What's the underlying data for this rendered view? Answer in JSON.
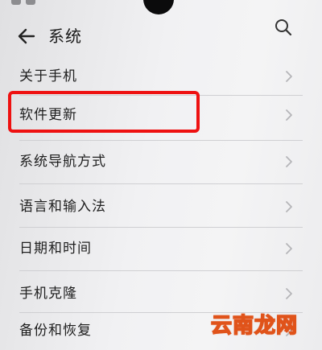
{
  "header": {
    "title": "系统",
    "back_icon": "back-arrow-icon",
    "search_icon": "search-icon"
  },
  "status_bar": {
    "icons": [
      "notification-icon",
      "notification-icon"
    ]
  },
  "menu": {
    "items": [
      {
        "label": "关于手机"
      },
      {
        "label": "软件更新"
      },
      {
        "label": "系统导航方式"
      },
      {
        "label": "语言和输入法"
      },
      {
        "label": "日期和时间"
      },
      {
        "label": "手机克隆"
      },
      {
        "label": "备份和恢复"
      }
    ],
    "highlighted_item": "软件更新",
    "highlight_color": "#ee1111"
  },
  "watermark": {
    "text": "云南龙网",
    "color": "#e0531a"
  }
}
